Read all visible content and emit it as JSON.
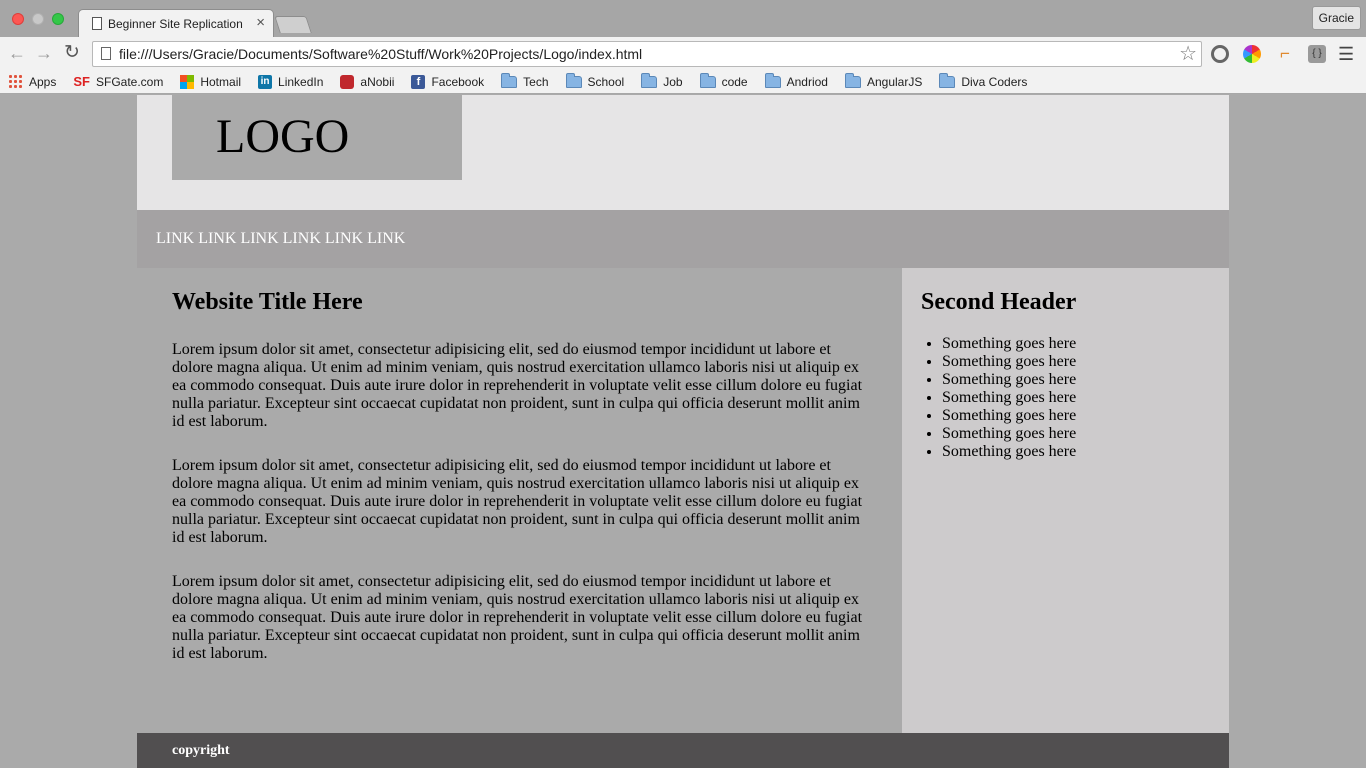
{
  "browser": {
    "tab_title": "Beginner Site Replication",
    "tab_close": "×",
    "profile": "Gracie",
    "url": "file:///Users/Gracie/Documents/Software%20Stuff/Work%20Projects/Logo/index.html",
    "bookmarks": [
      "Apps",
      "SFGate.com",
      "Hotmail",
      "LinkedIn",
      "aNobii",
      "Facebook",
      "Tech",
      "School",
      "Job",
      "code",
      "Andriod",
      "AngularJS",
      "Diva Coders"
    ]
  },
  "page": {
    "logo": "LOGO",
    "nav_links": [
      "LINK",
      "LINK",
      "LINK",
      "LINK",
      "LINK",
      "LINK"
    ],
    "main_title": "Website Title Here",
    "paragraphs": [
      "Lorem ipsum dolor sit amet, consectetur adipisicing elit, sed do eiusmod tempor incididunt ut labore et dolore magna aliqua. Ut enim ad minim veniam, quis nostrud exercitation ullamco laboris nisi ut aliquip ex ea commodo consequat. Duis aute irure dolor in reprehenderit in voluptate velit esse cillum dolore eu fugiat nulla pariatur. Excepteur sint occaecat cupidatat non proident, sunt in culpa qui officia deserunt mollit anim id est laborum.",
      "Lorem ipsum dolor sit amet, consectetur adipisicing elit, sed do eiusmod tempor incididunt ut labore et dolore magna aliqua. Ut enim ad minim veniam, quis nostrud exercitation ullamco laboris nisi ut aliquip ex ea commodo consequat. Duis aute irure dolor in reprehenderit in voluptate velit esse cillum dolore eu fugiat nulla pariatur. Excepteur sint occaecat cupidatat non proident, sunt in culpa qui officia deserunt mollit anim id est laborum.",
      "Lorem ipsum dolor sit amet, consectetur adipisicing elit, sed do eiusmod tempor incididunt ut labore et dolore magna aliqua. Ut enim ad minim veniam, quis nostrud exercitation ullamco laboris nisi ut aliquip ex ea commodo consequat. Duis aute irure dolor in reprehenderit in voluptate velit esse cillum dolore eu fugiat nulla pariatur. Excepteur sint occaecat cupidatat non proident, sunt in culpa qui officia deserunt mollit anim id est laborum."
    ],
    "sidebar_title": "Second Header",
    "sidebar_items": [
      "Something goes here",
      "Something goes here",
      "Something goes here",
      "Something goes here",
      "Something goes here",
      "Something goes here",
      "Something goes here"
    ],
    "footer": "copyright"
  },
  "icons": {
    "extension_1": "opera-like-circle-icon",
    "extension_2": "color-wheel-icon",
    "extension_3": "ruler-icon",
    "extension_4": "json-braces-icon"
  },
  "colors": {
    "header_bg": "#e6e5e6",
    "logo_bg": "#aaaaaa",
    "nav_bg": "#a4a2a3",
    "main_bg": "#aaaaaa",
    "sidebar_bg": "#cdcbcc",
    "footer_bg": "#514f50"
  }
}
